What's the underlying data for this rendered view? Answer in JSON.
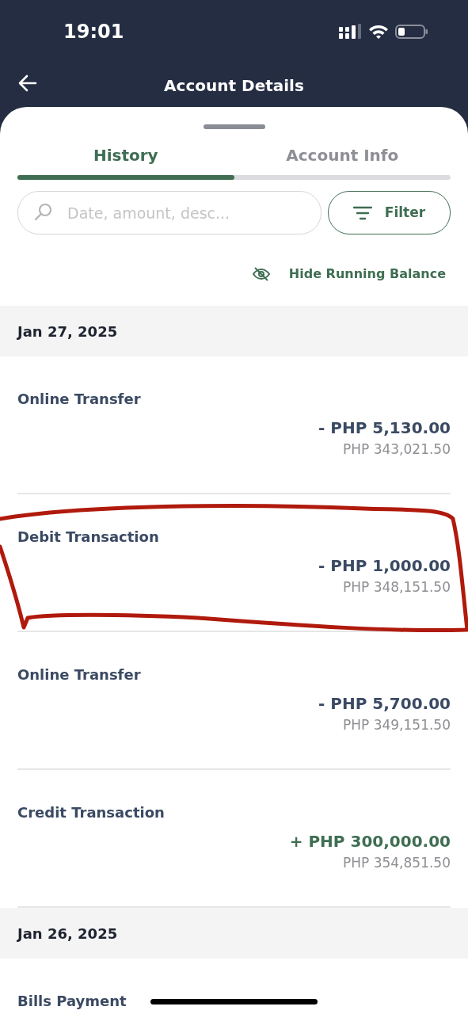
{
  "status_bar": {
    "time": "19:01"
  },
  "header": {
    "title": "Account Details"
  },
  "tabs": [
    {
      "label": "History",
      "selected": true
    },
    {
      "label": "Account Info",
      "selected": false
    }
  ],
  "search": {
    "placeholder": "Date, amount, desc..."
  },
  "filter_button": {
    "label": "Filter"
  },
  "running_balance_toggle": {
    "label": "Hide Running Balance"
  },
  "groups": [
    {
      "date": "Jan 27, 2025",
      "transactions": [
        {
          "title": "Online Transfer",
          "kind": "debit",
          "amount": "- PHP 5,130.00",
          "balance": "PHP 343,021.50"
        },
        {
          "title": "Debit Transaction",
          "kind": "debit",
          "amount": "- PHP 1,000.00",
          "balance": "PHP 348,151.50"
        },
        {
          "title": "Online Transfer",
          "kind": "debit",
          "amount": "- PHP 5,700.00",
          "balance": "PHP 349,151.50"
        },
        {
          "title": "Credit Transaction",
          "kind": "credit",
          "amount": "+ PHP 300,000.00",
          "balance": "PHP 354,851.50"
        }
      ]
    },
    {
      "date": "Jan 26, 2025",
      "transactions": [
        {
          "title": "Bills Payment"
        }
      ]
    }
  ]
}
